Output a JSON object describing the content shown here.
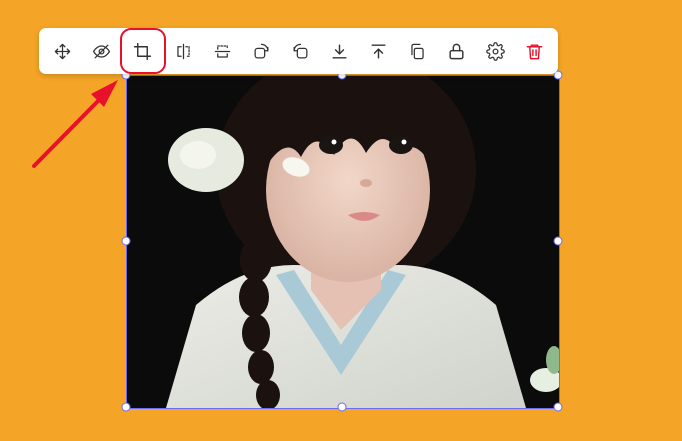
{
  "colors": {
    "background": "#F4A527",
    "toolbar": "#ffffff",
    "icon": "#333333",
    "delete_icon": "#e8102a",
    "selection": "#6c6cf0",
    "highlight": "#e8102a"
  },
  "toolbar": {
    "tools": [
      {
        "name": "move-icon"
      },
      {
        "name": "hide-icon"
      },
      {
        "name": "crop-icon",
        "active": true
      },
      {
        "name": "flip-horizontal-icon"
      },
      {
        "name": "flip-vertical-icon"
      },
      {
        "name": "rotate-right-icon"
      },
      {
        "name": "rotate-left-icon"
      },
      {
        "name": "send-to-back-icon"
      },
      {
        "name": "bring-to-front-icon"
      },
      {
        "name": "duplicate-icon"
      },
      {
        "name": "lock-icon"
      },
      {
        "name": "settings-icon"
      },
      {
        "name": "delete-icon"
      }
    ]
  },
  "image": {
    "subject": "photo-of-child"
  }
}
